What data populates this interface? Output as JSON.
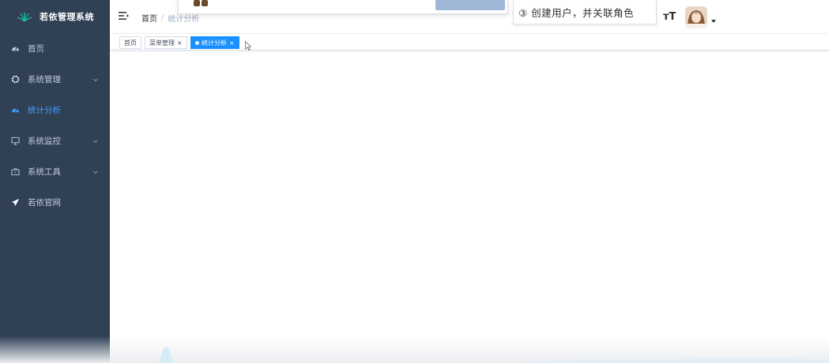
{
  "app": {
    "title": "若依管理系统"
  },
  "sidebar": {
    "items": [
      {
        "label": "首页",
        "icon": "dashboard-icon",
        "expandable": false,
        "active": false
      },
      {
        "label": "系统管理",
        "icon": "gear-icon",
        "expandable": true,
        "active": false
      },
      {
        "label": "统计分析",
        "icon": "dashboard-icon",
        "expandable": false,
        "active": true
      },
      {
        "label": "系统监控",
        "icon": "monitor-icon",
        "expandable": true,
        "active": false
      },
      {
        "label": "系统工具",
        "icon": "toolbox-icon",
        "expandable": true,
        "active": false
      },
      {
        "label": "若依官网",
        "icon": "send-icon",
        "expandable": false,
        "active": false
      }
    ]
  },
  "breadcrumb": {
    "home": "首页",
    "separator": "/",
    "current": "统计分析"
  },
  "tags": [
    {
      "label": "首页",
      "active": false,
      "closable": false
    },
    {
      "label": "菜单管理",
      "active": false,
      "closable": true,
      "close": "×"
    },
    {
      "label": "统计分析",
      "active": true,
      "closable": true,
      "close": "×"
    }
  ],
  "header": {
    "tip": "③ 创建用户，并关联角色",
    "size_icon": "тT"
  },
  "colors": {
    "sidebar_bg": "#304156",
    "sidebar_text": "#bfcbd9",
    "accent": "#409eff",
    "tag_active": "#1890ff"
  }
}
